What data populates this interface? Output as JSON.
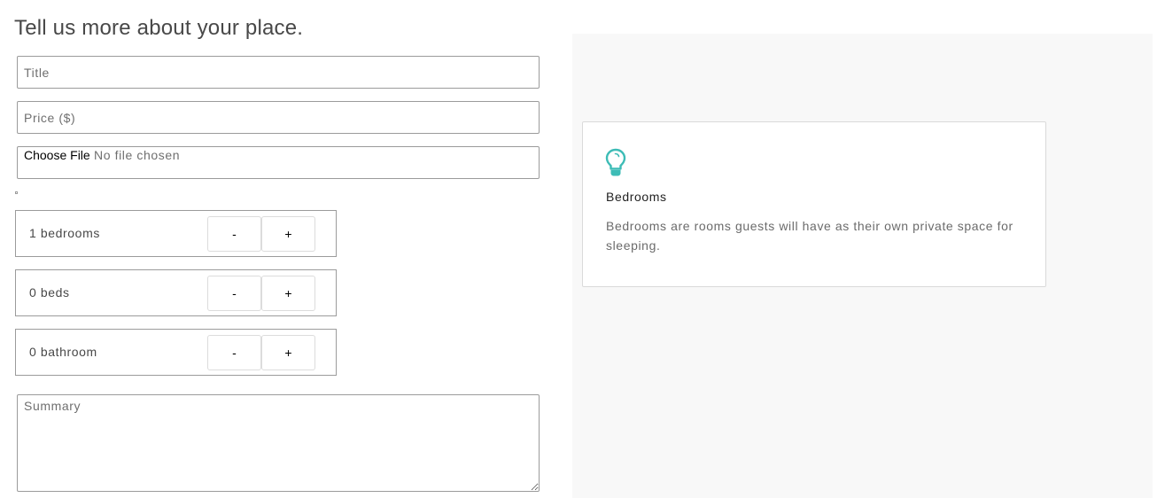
{
  "form": {
    "heading": "Tell us more about your place.",
    "title_placeholder": "Title",
    "price_placeholder": "Price ($)",
    "file_button_label": "Choose File",
    "file_status": "No file chosen",
    "summary_placeholder": "Summary"
  },
  "steppers": [
    {
      "value": 1,
      "label": "1 bedrooms",
      "minus_label": "-",
      "plus_label": "+"
    },
    {
      "value": 0,
      "label": "0 beds",
      "minus_label": "-",
      "plus_label": "+"
    },
    {
      "value": 0,
      "label": "0 bathroom",
      "minus_label": "-",
      "plus_label": "+"
    }
  ],
  "tip": {
    "icon": "lightbulb-icon",
    "icon_color": "#3dbcb6",
    "title": "Bedrooms",
    "body": "Bedrooms are rooms guests will have as their own private space for sleeping."
  },
  "colors": {
    "side_panel_bg": "#f8f8f8",
    "accent": "#3dbcb6"
  }
}
